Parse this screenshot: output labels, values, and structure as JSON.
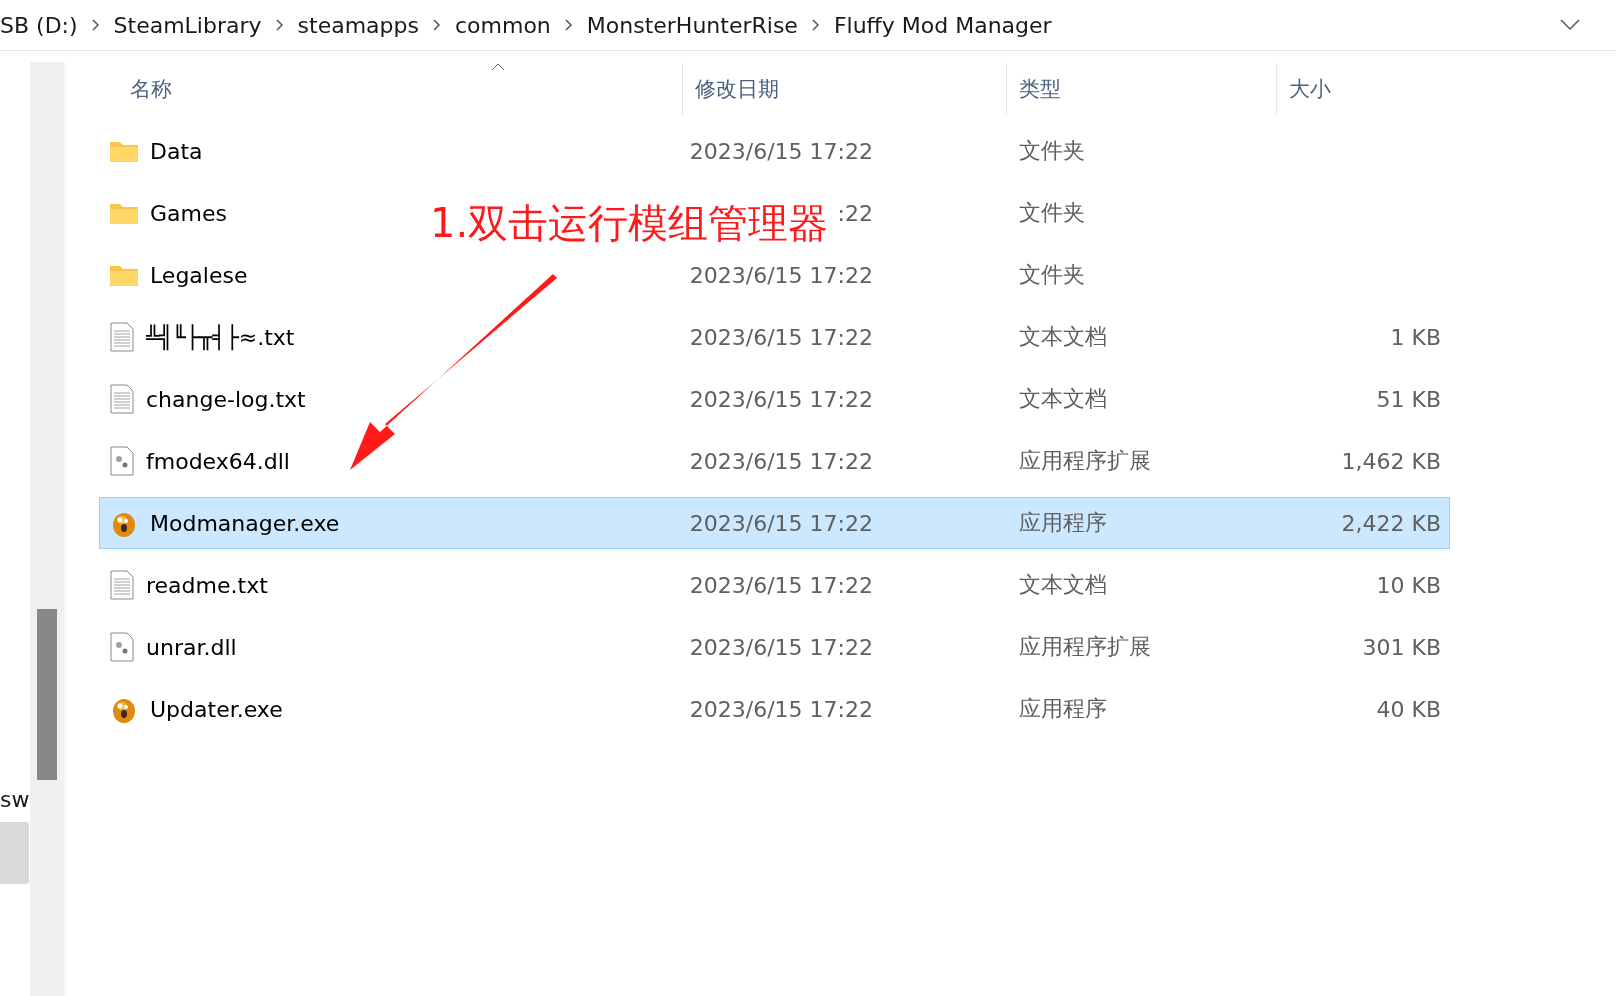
{
  "breadcrumb": [
    "SB (D:)",
    "SteamLibrary",
    "steamapps",
    "common",
    "MonsterHunterRise",
    "Fluffy Mod Manager"
  ],
  "side_text": "sw",
  "columns": [
    "名称",
    "修改日期",
    "类型",
    "大小"
  ],
  "files": [
    {
      "name": "Data",
      "date": "2023/6/15 17:22",
      "type": "文件夹",
      "kind": "folder",
      "selected": false
    },
    {
      "name": "Games",
      "date": ":22",
      "type": "文件夹",
      "kind": "folder",
      "selected": false
    },
    {
      "name": "Legalese",
      "date": "2023/6/15 17:22",
      "type": "文件夹",
      "kind": "folder",
      "selected": false
    },
    {
      "name": "╩╣╙├╥╡├≈.txt",
      "date": "2023/6/15 17:22",
      "type": "文本文档",
      "size": "1 KB",
      "kind": "text",
      "selected": false
    },
    {
      "name": "change-log.txt",
      "date": "2023/6/15 17:22",
      "type": "文本文档",
      "size": "51 KB",
      "kind": "text",
      "selected": false
    },
    {
      "name": "fmodex64.dll",
      "date": "2023/6/15 17:22",
      "type": "应用程序扩展",
      "size": "1,462 KB",
      "kind": "dll",
      "selected": false
    },
    {
      "name": "Modmanager.exe",
      "date": "2023/6/15 17:22",
      "type": "应用程序",
      "size": "2,422 KB",
      "kind": "exe",
      "selected": true
    },
    {
      "name": "readme.txt",
      "date": "2023/6/15 17:22",
      "type": "文本文档",
      "size": "10 KB",
      "kind": "text",
      "selected": false
    },
    {
      "name": "unrar.dll",
      "date": "2023/6/15 17:22",
      "type": "应用程序扩展",
      "size": "301 KB",
      "kind": "dll",
      "selected": false
    },
    {
      "name": "Updater.exe",
      "date": "2023/6/15 17:22",
      "type": "应用程序",
      "size": "40 KB",
      "kind": "exe",
      "selected": false
    }
  ],
  "annotation": "1.双击运行模组管理器"
}
